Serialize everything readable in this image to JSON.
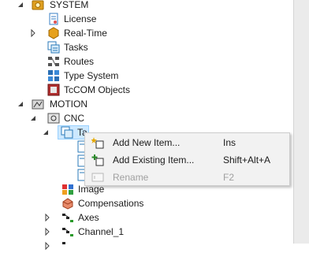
{
  "tree": {
    "items": [
      {
        "label": "SYSTEM",
        "icon": "system-gear-icon"
      },
      {
        "label": "License",
        "icon": "license-icon"
      },
      {
        "label": "Real-Time",
        "icon": "realtime-icon"
      },
      {
        "label": "Tasks",
        "icon": "tasks-icon"
      },
      {
        "label": "Routes",
        "icon": "routes-icon"
      },
      {
        "label": "Type System",
        "icon": "type-system-icon"
      },
      {
        "label": "TcCOM Objects",
        "icon": "tccom-objects-icon"
      },
      {
        "label": "MOTION",
        "icon": "motion-icon"
      },
      {
        "label": "CNC",
        "icon": "cnc-icon"
      },
      {
        "label": "Ta",
        "icon": "cnc-task-icon"
      },
      {
        "label": "Image",
        "icon": "image-icon"
      },
      {
        "label": "Compensations",
        "icon": "compensations-icon"
      },
      {
        "label": "Axes",
        "icon": "axes-icon"
      },
      {
        "label": "Channel_1",
        "icon": "channel-icon"
      }
    ]
  },
  "context_menu": {
    "items": [
      {
        "label": "Add New Item...",
        "shortcut": "Ins",
        "icon": "add-new-item-icon",
        "enabled": true
      },
      {
        "label": "Add Existing Item...",
        "shortcut": "Shift+Alt+A",
        "icon": "add-existing-item-icon",
        "enabled": true
      },
      {
        "label": "Rename",
        "shortcut": "F2",
        "icon": "rename-icon",
        "enabled": false
      }
    ]
  },
  "colors": {
    "selection": "#cce8ff",
    "menu_background": "#f2f2f2",
    "disabled_text": "#a0a0a0"
  }
}
